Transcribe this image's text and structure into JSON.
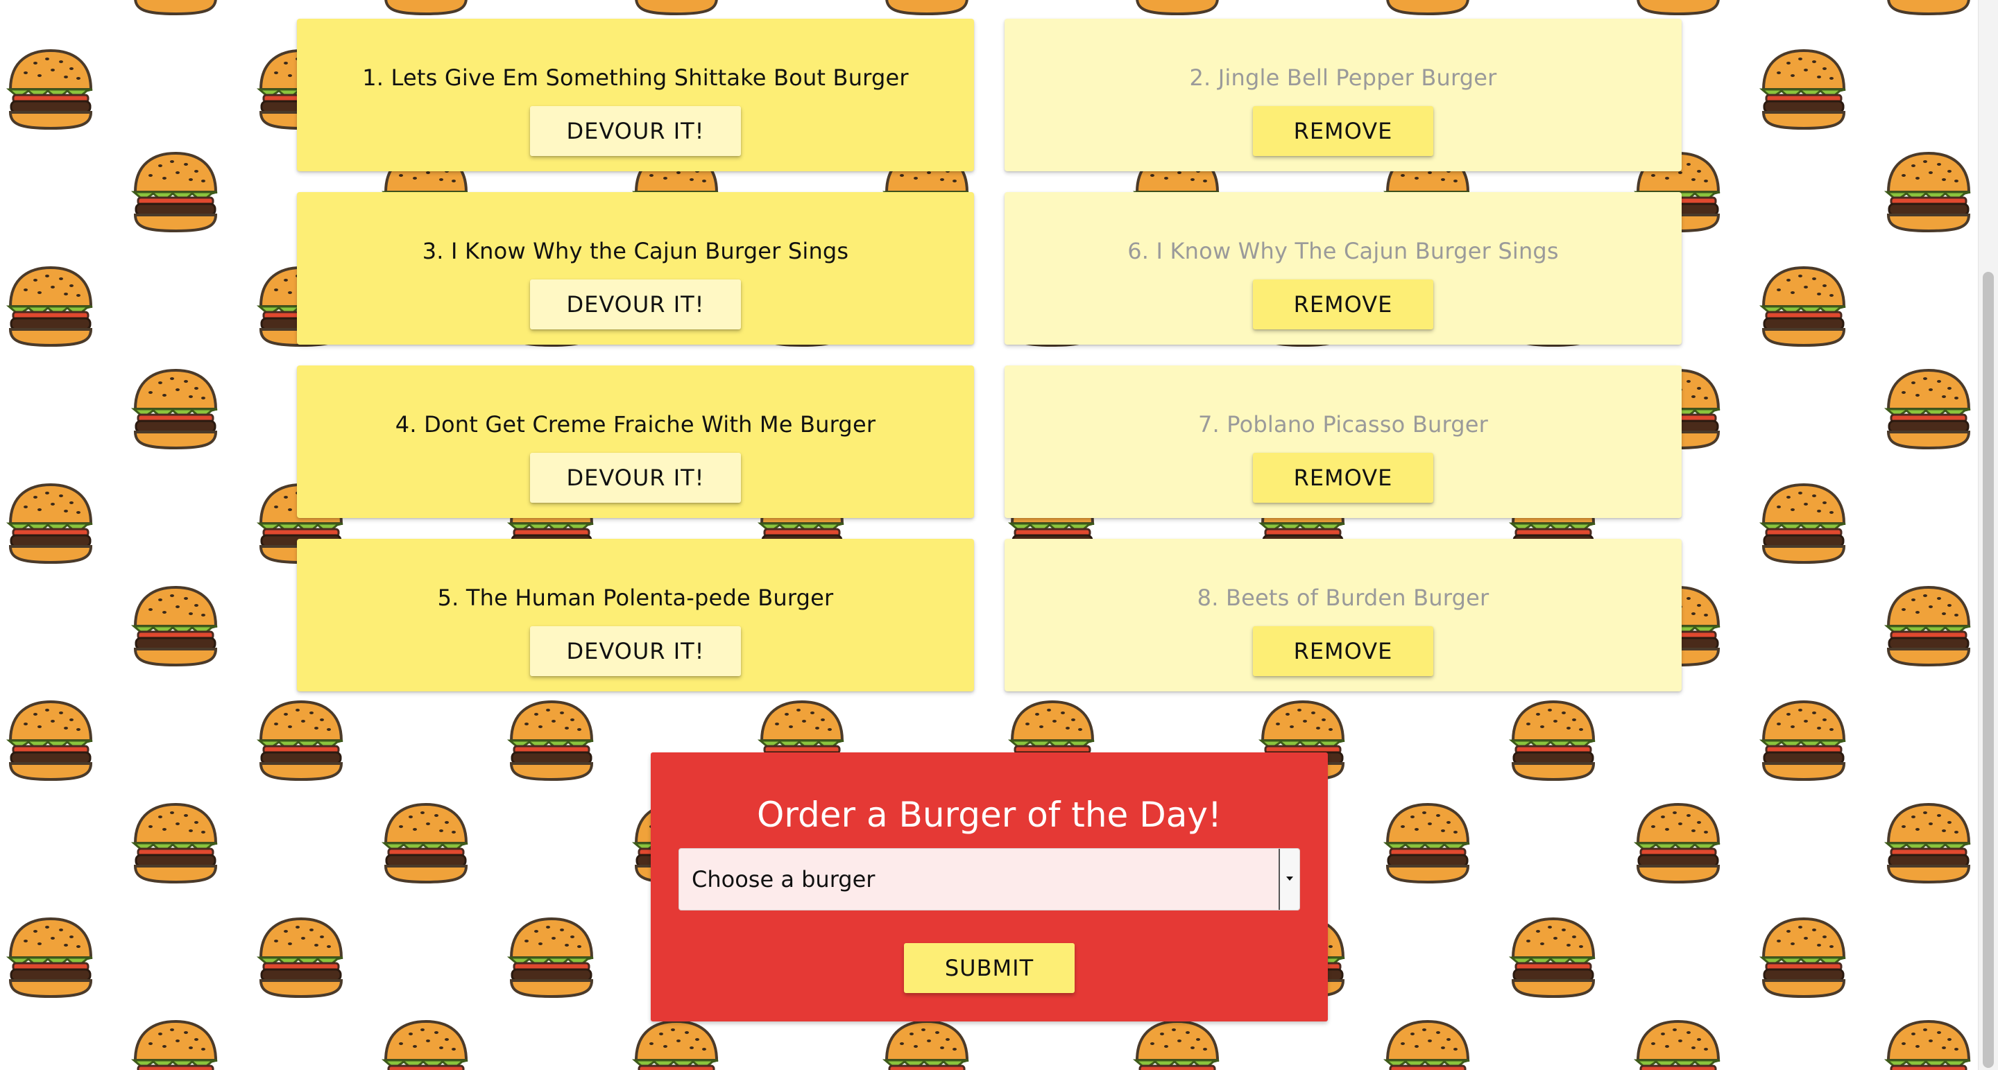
{
  "colors": {
    "ready_card": "#fdee75",
    "eaten_card": "#fef9bf",
    "order_panel": "#e53935",
    "button_yellow": "#fdee75",
    "button_light": "#fff8c4"
  },
  "background_pattern": {
    "icon": "burger-icon"
  },
  "ready_burgers": [
    {
      "title": "1. Lets Give Em Something Shittake Bout Burger",
      "button_label": "DEVOUR IT!"
    },
    {
      "title": "3. I Know Why the Cajun Burger Sings",
      "button_label": "DEVOUR IT!"
    },
    {
      "title": "4. Dont Get Creme Fraiche With Me Burger",
      "button_label": "DEVOUR IT!"
    },
    {
      "title": "5. The Human Polenta-pede Burger",
      "button_label": "DEVOUR IT!"
    }
  ],
  "devoured_burgers": [
    {
      "title": "2. Jingle Bell Pepper Burger",
      "button_label": "REMOVE"
    },
    {
      "title": "6. I Know Why The Cajun Burger Sings",
      "button_label": "REMOVE"
    },
    {
      "title": "7. Poblano Picasso Burger",
      "button_label": "REMOVE"
    },
    {
      "title": "8. Beets of Burden Burger",
      "button_label": "REMOVE"
    }
  ],
  "order_form": {
    "title": "Order a Burger of the Day!",
    "select_value": "Choose a burger",
    "submit_label": "SUBMIT"
  }
}
